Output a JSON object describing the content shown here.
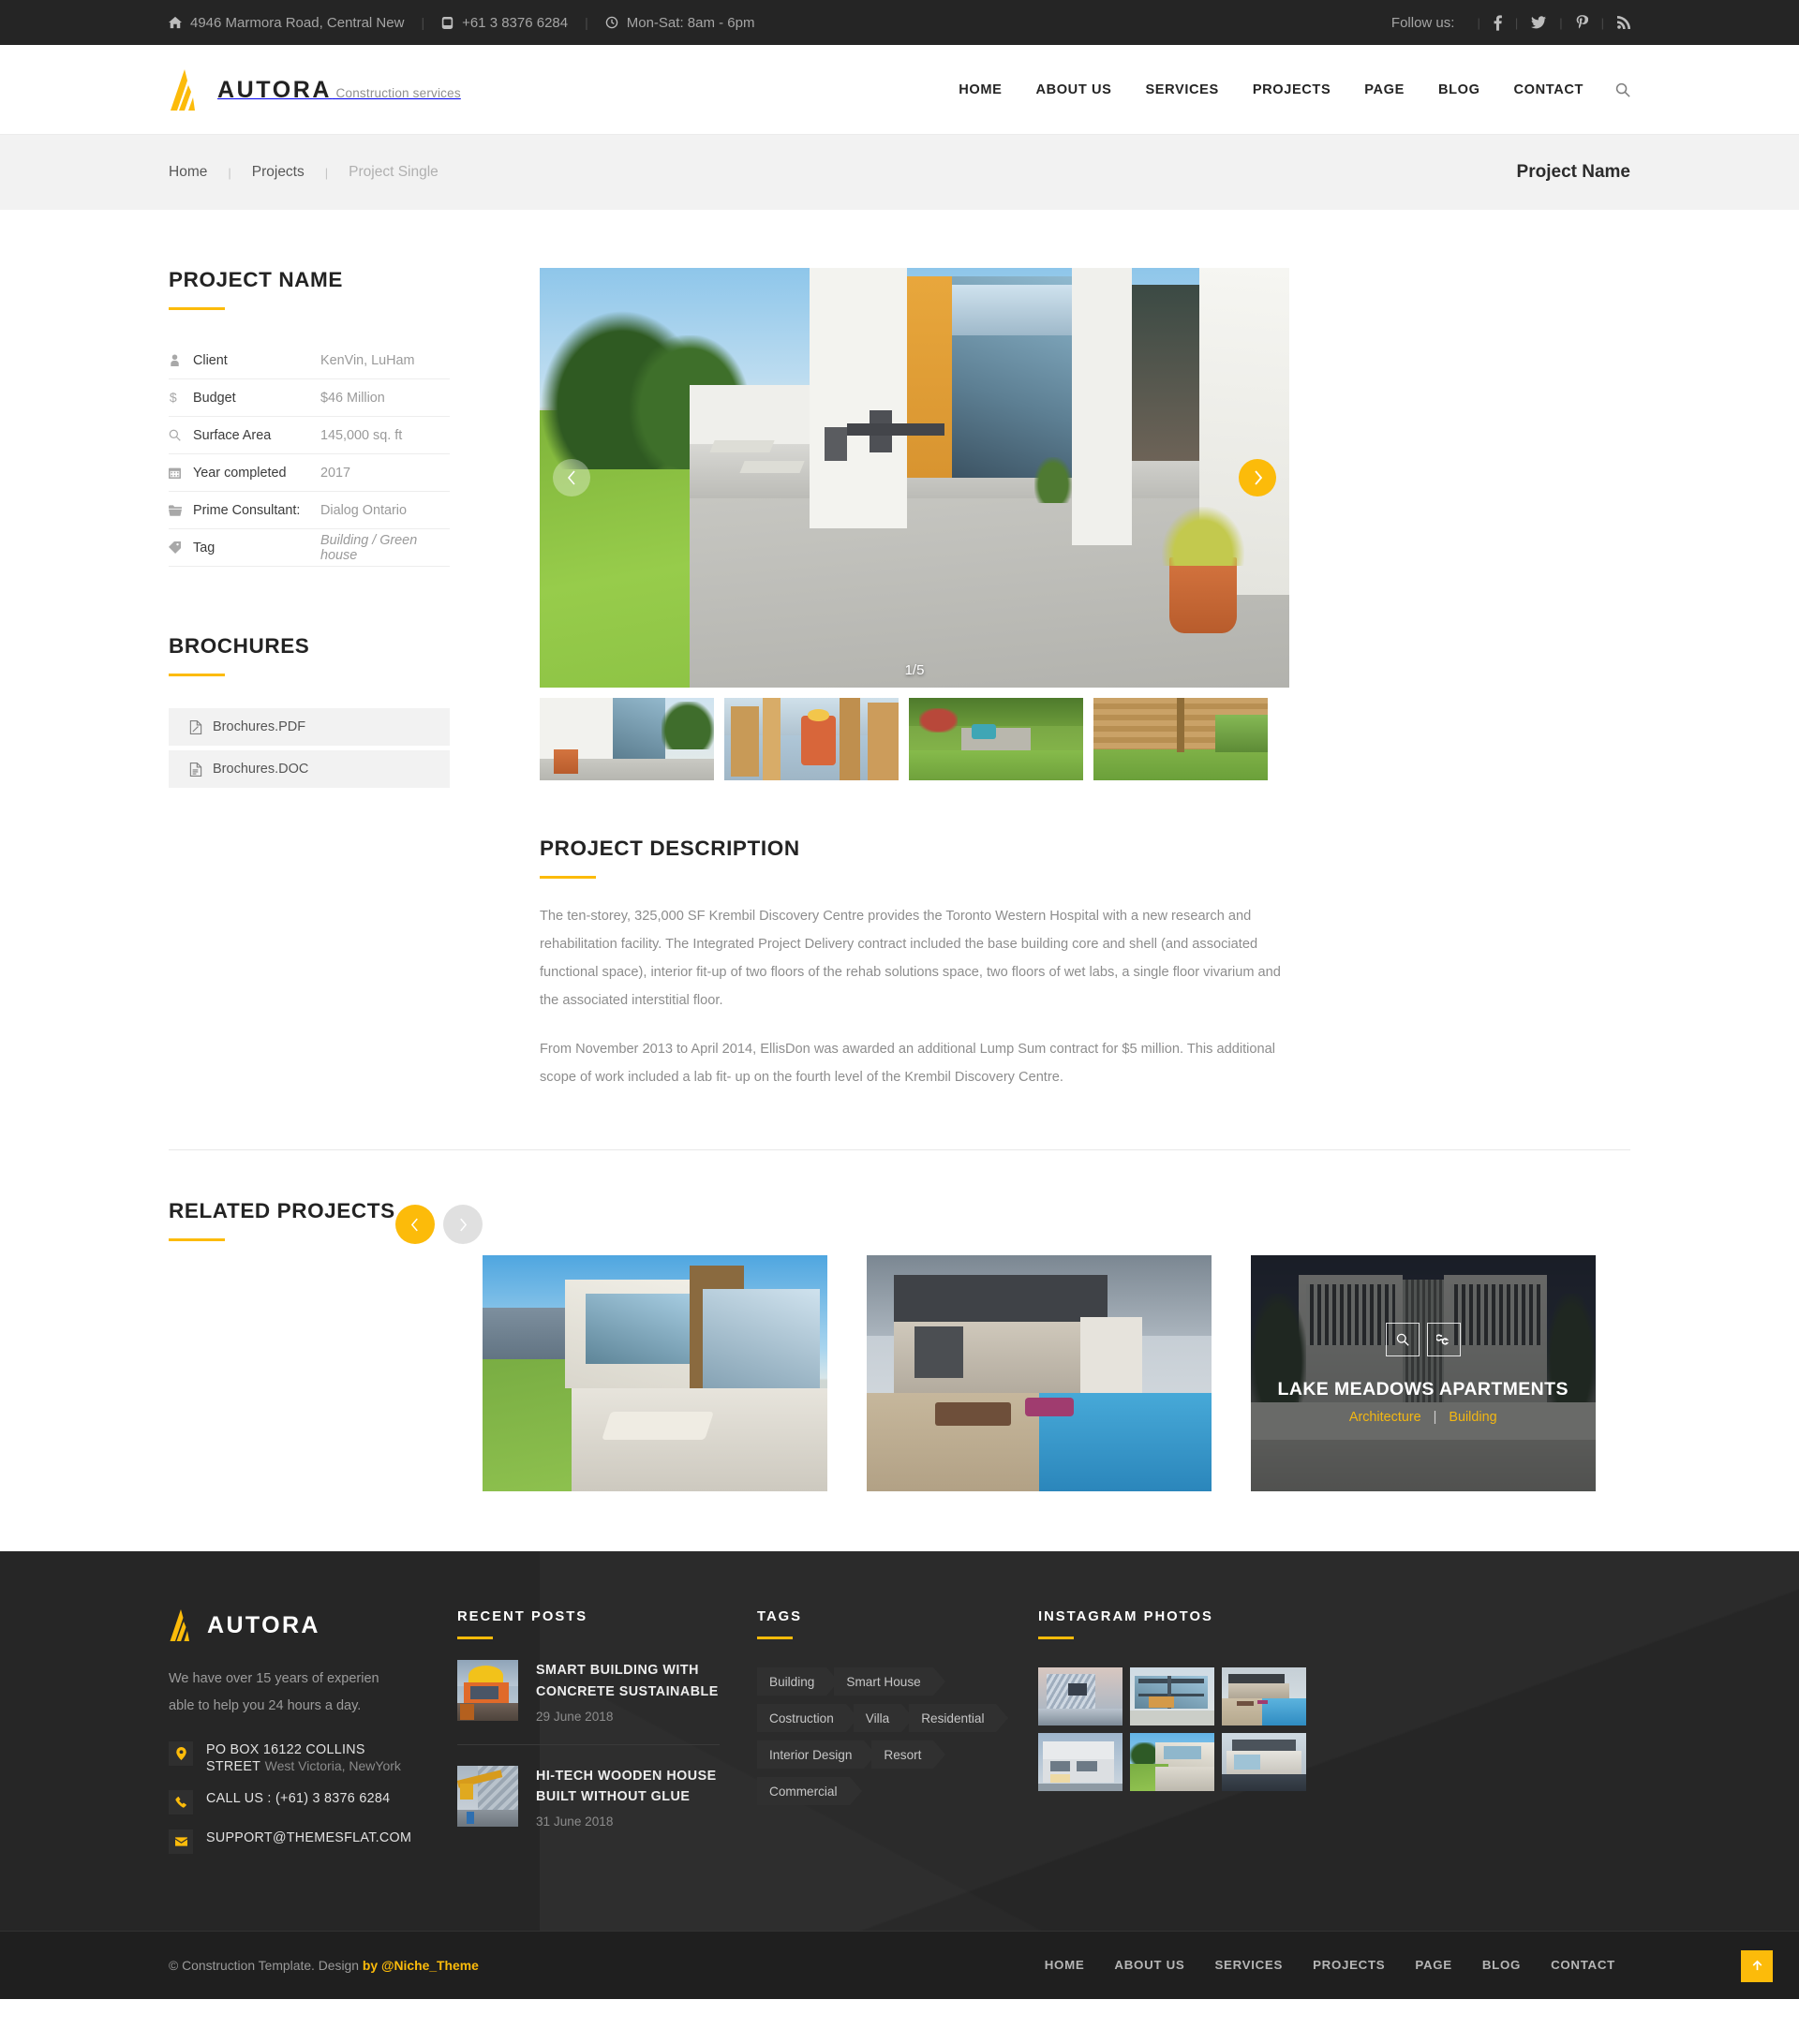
{
  "topbar": {
    "address": "4946 Marmora Road, Central New",
    "phone": "+61 3 8376 6284",
    "hours": "Mon-Sat: 8am - 6pm",
    "follow_label": "Follow us:",
    "socials": [
      "facebook-icon",
      "twitter-icon",
      "pinterest-icon",
      "rss-icon"
    ]
  },
  "header": {
    "brand_name": "AUTORA",
    "brand_sub": "Construction services",
    "nav": [
      "HOME",
      "ABOUT US",
      "SERVICES",
      "PROJECTS",
      "PAGE",
      "BLOG",
      "CONTACT"
    ],
    "search_icon": "search-icon"
  },
  "breadcrumb": {
    "items": [
      "Home",
      "Projects",
      "Project Single"
    ],
    "page_title": "Project Name"
  },
  "project": {
    "title": "PROJECT NAME",
    "specs": [
      {
        "icon": "user-icon",
        "key": "Client",
        "value": "KenVin, LuHam",
        "italic": false
      },
      {
        "icon": "dollar-icon",
        "key": "Budget",
        "value": "$46 Million",
        "italic": false
      },
      {
        "icon": "search-icon",
        "key": "Surface Area",
        "value": "145,000 sq. ft",
        "italic": false
      },
      {
        "icon": "calendar-icon",
        "key": "Year completed",
        "value": "2017",
        "italic": false
      },
      {
        "icon": "folder-icon",
        "key": "Prime Consultant:",
        "value": "Dialog Ontario",
        "italic": false
      },
      {
        "icon": "tag-icon",
        "key": "Tag",
        "value": "Building / Green house",
        "italic": true
      }
    ]
  },
  "brochures": {
    "title": "BROCHURES",
    "files": [
      {
        "icon": "pdf-file-icon",
        "name": "Brochures.PDF"
      },
      {
        "icon": "doc-file-icon",
        "name": "Brochures.DOC"
      }
    ]
  },
  "slider": {
    "counter": "1/5",
    "prev_icon": "chevron-left-icon",
    "next_icon": "chevron-right-icon",
    "thumbs": 4
  },
  "description": {
    "title": "PROJECT DESCRIPTION",
    "paragraphs": [
      "The ten-storey, 325,000 SF Krembil Discovery Centre provides the Toronto Western Hospital with a new research and rehabilitation facility. The Integrated Project Delivery contract included the base building core and shell (and associated functional space), interior fit-up of two floors of the rehab solutions space, two floors of wet labs, a single floor vivarium and the associated interstitial floor.",
      "From November 2013 to April 2014, EllisDon was awarded an additional Lump Sum contract for $5 million. This additional scope of work included a lab fit- up on the fourth level of the Krembil Discovery Centre."
    ]
  },
  "related": {
    "title": "RELATED PROJECTS",
    "prev_icon": "chevron-left-icon",
    "next_icon": "chevron-right-icon",
    "cards": [
      {
        "name": "",
        "categories": []
      },
      {
        "name": "",
        "categories": []
      },
      {
        "name": "LAKE MEADOWS APARTMENTS",
        "categories": [
          "Architecture",
          "Building"
        ],
        "zoom_icon": "search-icon",
        "link_icon": "link-icon"
      }
    ]
  },
  "footer": {
    "brand_name": "AUTORA",
    "about": "We have over 15 years of experien able to help you 24 hours a day.",
    "contacts": [
      {
        "icon": "location-icon",
        "line1": "PO BOX 16122 COLLINS STREET",
        "line2": "West Victoria, NewYork"
      },
      {
        "icon": "phone-icon",
        "line1": "CALL US : (+61) 3 8376 6284",
        "line2": ""
      },
      {
        "icon": "mail-icon",
        "line1": "SUPPORT@THEMESFLAT.COM",
        "line2": ""
      }
    ],
    "posts_title": "RECENT POSTS",
    "posts": [
      {
        "title": "SMART BUILDING WITH CONCRETE SUSTAINABLE",
        "date": "29 June 2018"
      },
      {
        "title": "HI-TECH WOODEN HOUSE BUILT WITHOUT GLUE",
        "date": "31 June 2018"
      }
    ],
    "tags_title": "TAGS",
    "tags": [
      "Building",
      "Smart House",
      "Costruction",
      "Villa",
      "Residential",
      "Interior Design",
      "Resort",
      "Commercial"
    ],
    "insta_title": "INSTAGRAM PHOTOS",
    "insta_count": 6,
    "copyright_pre": "©  Construction Template. Design ",
    "copyright_hl": "by @Niche_Theme",
    "bottom_nav": [
      "HOME",
      "ABOUT US",
      "SERVICES",
      "PROJECTS",
      "PAGE",
      "BLOG",
      "CONTACT"
    ],
    "to_top_icon": "arrow-up-icon"
  },
  "colors": {
    "accent": "#fcbb0a",
    "dark": "#262626",
    "topbar": "#252525",
    "crumb_bg": "#f2f2f2"
  }
}
